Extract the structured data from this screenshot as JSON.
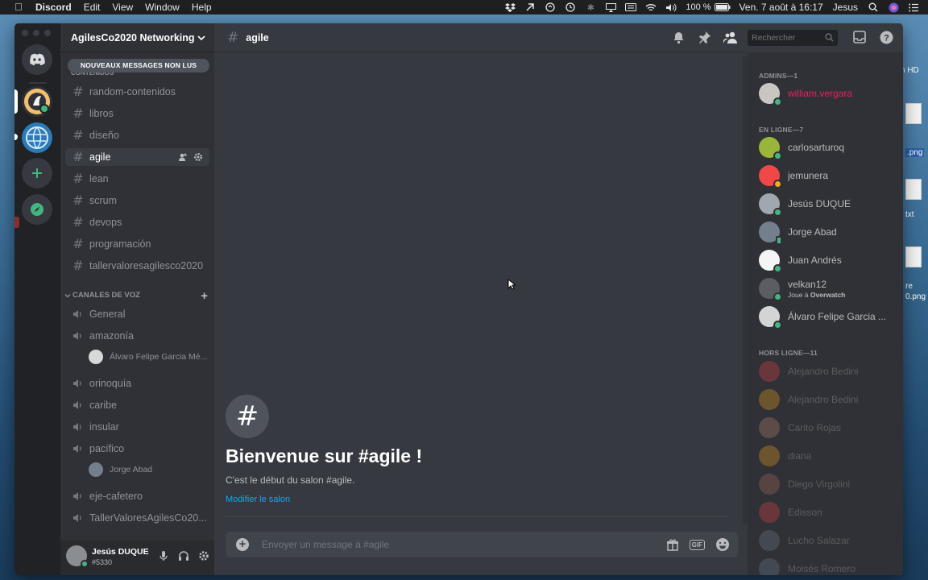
{
  "menubar": {
    "app": "Discord",
    "items": [
      "Edit",
      "View",
      "Window",
      "Help"
    ],
    "battery": "100 %",
    "datetime": "Ven. 7 août à 16:17",
    "user": "Jesus"
  },
  "desktop": {
    "labels": [
      "h HD",
      ".png",
      "txt",
      "re",
      "0.png"
    ]
  },
  "guild": {
    "name": "AgilesCo2020 Networking",
    "unread_pill": "NOUVEAUX MESSAGES NON LUS",
    "text_category_partial": "CONTENIDOS",
    "text_channels": [
      "random-contenidos",
      "libros",
      "diseño",
      "agile",
      "lean",
      "scrum",
      "devops",
      "programación",
      "tallervaloresagilesco2020"
    ],
    "voice_category": "CANALES DE VOZ",
    "voice_channels": [
      "General",
      "amazonía",
      "orinoquía",
      "caribe",
      "insular",
      "pacífico",
      "eje-cafetero",
      "TallerValoresAgilesCo20..."
    ],
    "voice_users": {
      "amazonia": "Álvaro Felipe Garcia Mé...",
      "pacifico": "Jorge Abad"
    }
  },
  "user": {
    "name": "Jesús DUQUE",
    "tag": "#5330"
  },
  "channel": {
    "name": "agile",
    "welcome_title": "Bienvenue sur #agile !",
    "welcome_sub": "C'est le début du salon #agile.",
    "edit_link": "Modifier le salon",
    "composer_placeholder": "Envoyer un message à #agile",
    "search_placeholder": "Rechercher"
  },
  "members": {
    "admins_header": "ADMINS—1",
    "online_header": "EN LIGNE—7",
    "offline_header": "HORS LIGNE—11",
    "admins": [
      {
        "name": "william.vergara",
        "color": "#e91e63"
      }
    ],
    "online": [
      {
        "name": "carlosarturoq",
        "status": "online"
      },
      {
        "name": "jemunera",
        "status": "idle"
      },
      {
        "name": "Jesús DUQUE",
        "status": "online"
      },
      {
        "name": "Jorge Abad",
        "status": "mobile"
      },
      {
        "name": "Juan Andrés",
        "status": "online"
      },
      {
        "name": "velkan12",
        "activity_prefix": "Joue à",
        "activity": "Overwatch",
        "status": "online"
      },
      {
        "name": "Álvaro Felipe Garcia ...",
        "status": "online"
      }
    ],
    "offline": [
      "Alejandro Bedini",
      "Alejandro Bedini",
      "Carito Rojas",
      "diana",
      "Diego Virgolini",
      "Edisson",
      "Lucho Salazar",
      "Moisés Romero"
    ]
  },
  "colors": {
    "accent_link": "#00b0f4",
    "online": "#43b581",
    "idle": "#faa61a",
    "admin_name": "#e91e63"
  }
}
